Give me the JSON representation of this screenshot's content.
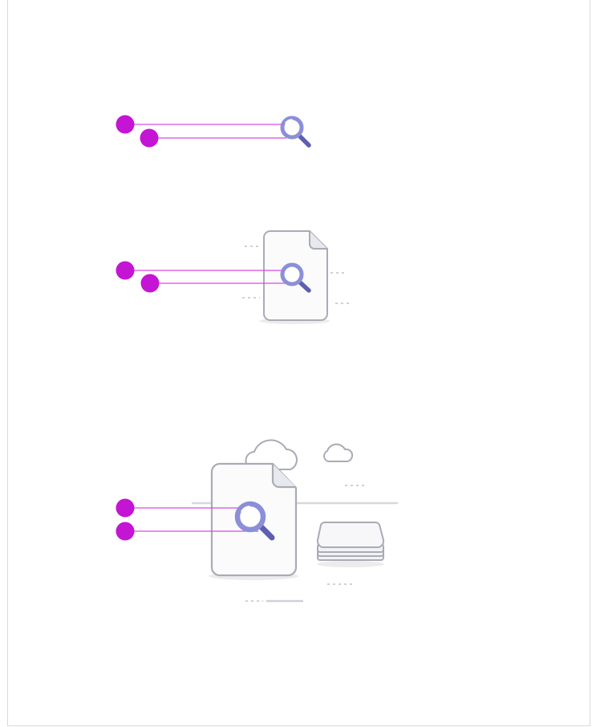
{
  "colors": {
    "annotation_pin": "#c414d4",
    "annotation_line": "#d64be3",
    "magnifier_fill": "#8b8fd8",
    "magnifier_stroke": "#5e5fb0",
    "illustration_outline": "#a9abb6",
    "illustration_fill": "#f7f7f9",
    "dash": "#cfd1d8",
    "shadow": "#ececef"
  },
  "illustrations": [
    {
      "id": "search-icon-only",
      "pins": 2,
      "elements": [
        "magnifier-icon"
      ]
    },
    {
      "id": "document-search",
      "pins": 2,
      "elements": [
        "document-icon",
        "magnifier-icon"
      ]
    },
    {
      "id": "cloud-document-storage-search",
      "pins": 2,
      "elements": [
        "cloud-icon",
        "document-icon",
        "magnifier-icon",
        "storage-stack-icon"
      ]
    }
  ]
}
